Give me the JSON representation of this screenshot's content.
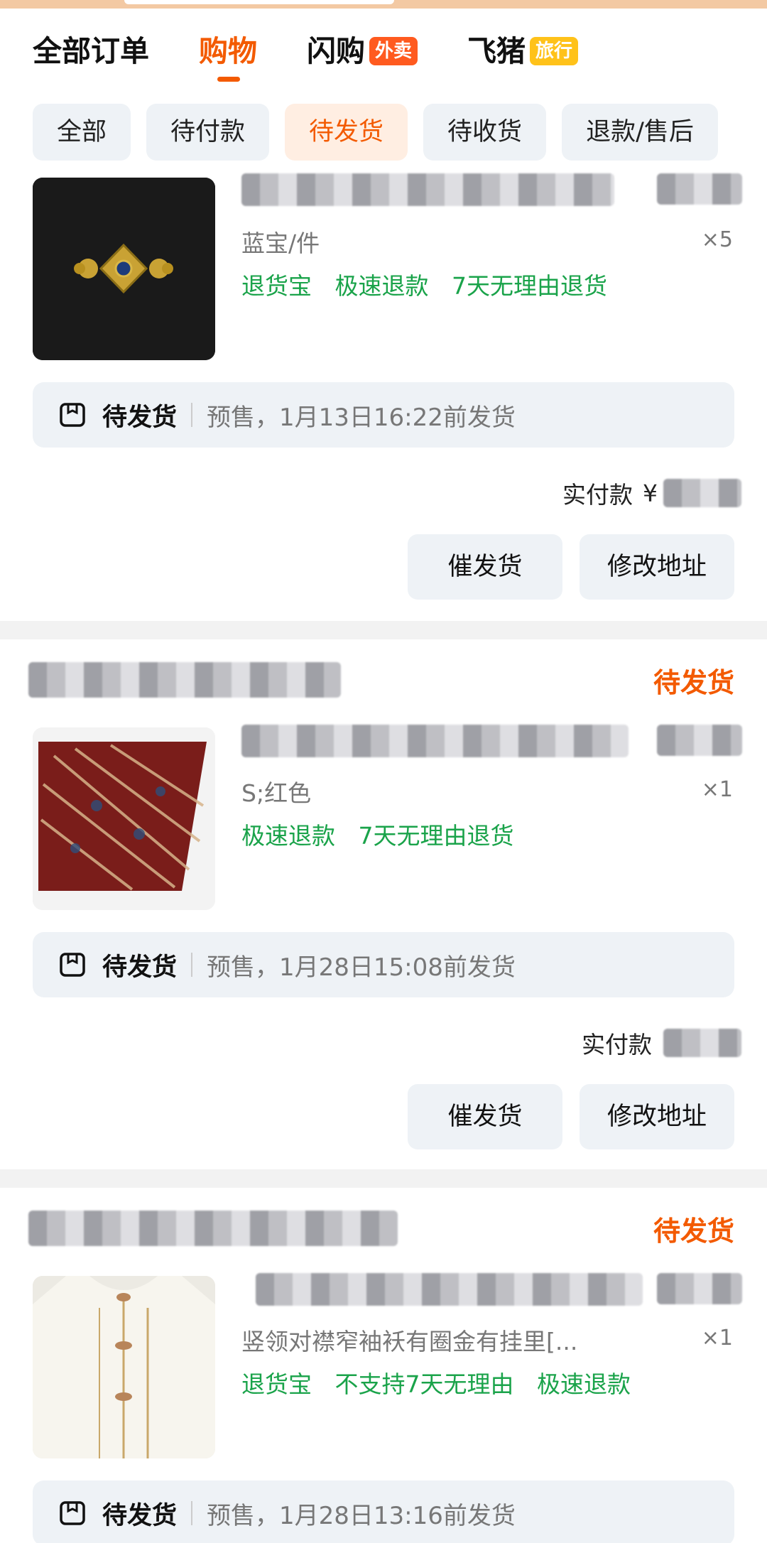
{
  "tabs": [
    {
      "label": "全部订单",
      "active": false
    },
    {
      "label": "购物",
      "active": true
    },
    {
      "label": "闪购",
      "active": false,
      "badge": "外卖"
    },
    {
      "label": "飞猪",
      "active": false,
      "badge": "旅行"
    }
  ],
  "filters": [
    "全部",
    "待付款",
    "待发货",
    "待收货",
    "退款/售后"
  ],
  "active_filter": "待发货",
  "orders": [
    {
      "status": "",
      "sku": "蓝宝/件",
      "qty": "×5",
      "service_tags": [
        "退货宝",
        "极速退款",
        "7天无理由退货"
      ],
      "ship_status": "待发货",
      "ship_info": "预售，1月13日16:22前发货",
      "paid_label": "实付款",
      "currency": "¥",
      "buttons": [
        "催发货",
        "修改地址"
      ]
    },
    {
      "status": "待发货",
      "sku": "S;红色",
      "qty": "×1",
      "service_tags": [
        "极速退款",
        "7天无理由退货"
      ],
      "ship_status": "待发货",
      "ship_info": "预售，1月28日15:08前发货",
      "paid_label": "实付款",
      "buttons": [
        "催发货",
        "修改地址"
      ]
    },
    {
      "status": "待发货",
      "sku": "竖领对襟窄袖袄有圈金有挂里[...",
      "qty": "×1",
      "service_tags": [
        "退货宝",
        "不支持7天无理由",
        "极速退款"
      ],
      "ship_status": "待发货",
      "ship_info": "预售，1月28日13:16前发货"
    }
  ],
  "colors": {
    "accent": "#f35a00",
    "green": "#1aa34a",
    "chip_bg": "#eef2f6"
  }
}
